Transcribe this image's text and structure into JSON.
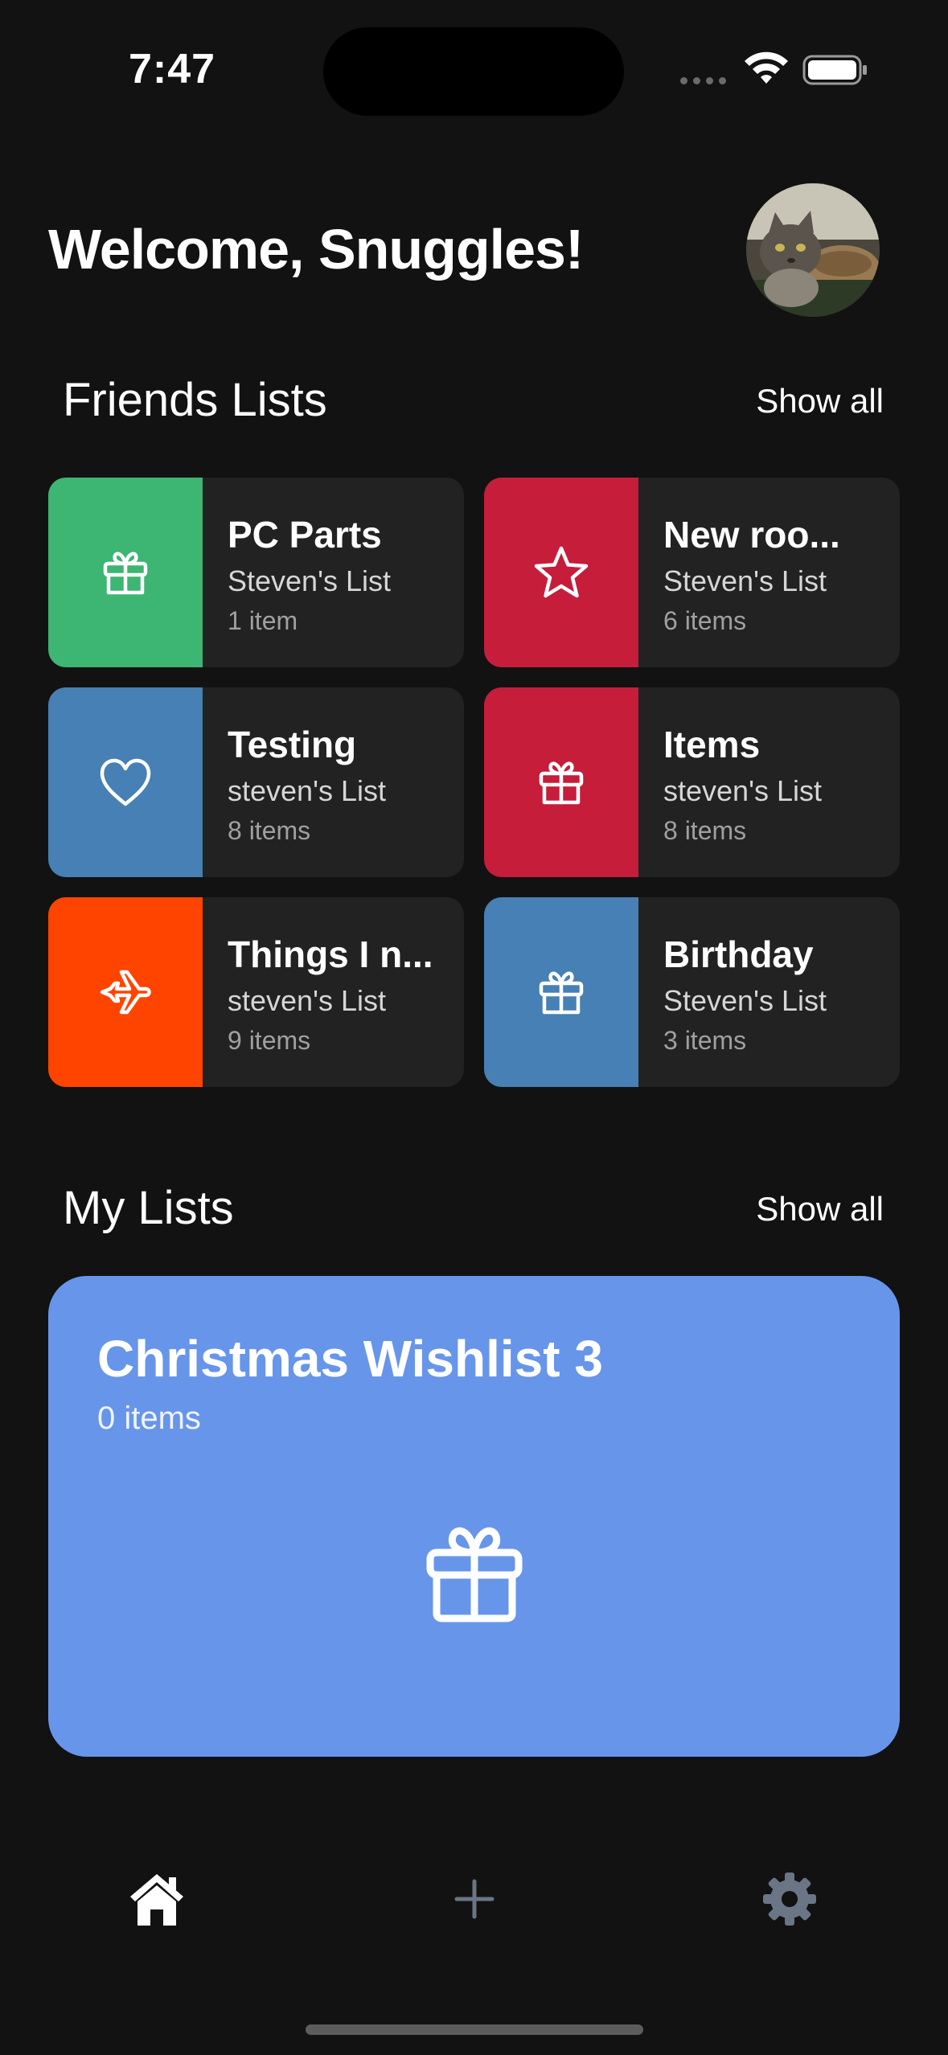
{
  "status_bar": {
    "time": "7:47"
  },
  "header": {
    "welcome": "Welcome, Snuggles!"
  },
  "friends_section": {
    "title": "Friends Lists",
    "show_all": "Show all",
    "lists": [
      {
        "title": "PC Parts",
        "owner": "Steven's List",
        "count": "1 item",
        "color": "#3db573",
        "icon": "gift-icon"
      },
      {
        "title": "New roo...",
        "owner": "Steven's List",
        "count": "6 items",
        "color": "#c51d3a",
        "icon": "star-icon"
      },
      {
        "title": "Testing",
        "owner": "steven's List",
        "count": "8 items",
        "color": "#4680b4",
        "icon": "heart-icon"
      },
      {
        "title": "Items",
        "owner": "steven's List",
        "count": "8 items",
        "color": "#c51d3a",
        "icon": "gift-icon"
      },
      {
        "title": "Things I n...",
        "owner": "steven's List",
        "count": "9 items",
        "color": "#ff4400",
        "icon": "airplane-icon"
      },
      {
        "title": "Birthday",
        "owner": "Steven's List",
        "count": "3 items",
        "color": "#4680b4",
        "icon": "gift-icon"
      }
    ]
  },
  "my_section": {
    "title": "My Lists",
    "show_all": "Show all",
    "list": {
      "title": "Christmas Wishlist 3",
      "count": "0 items",
      "color": "#6795ea",
      "icon": "gift-icon"
    }
  },
  "tab_bar": {
    "tabs": [
      {
        "icon": "home-icon",
        "active": true
      },
      {
        "icon": "plus-icon",
        "active": false
      },
      {
        "icon": "gear-icon",
        "active": false
      }
    ]
  }
}
